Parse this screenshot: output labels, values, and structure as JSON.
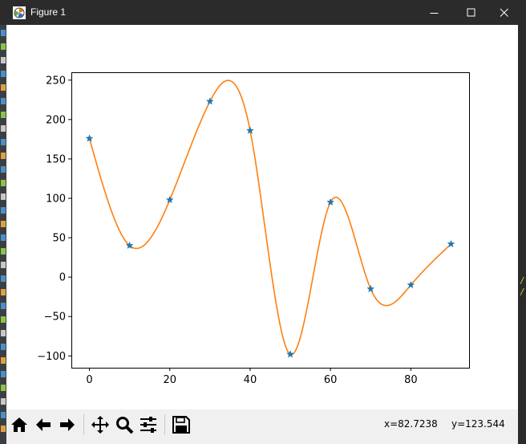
{
  "window": {
    "title": "Figure 1"
  },
  "icons": {
    "app": "matplotlib-figure-icon",
    "minimize": "minimize-icon",
    "maximize": "maximize-icon",
    "close": "close-icon"
  },
  "toolbar": {
    "buttons": [
      {
        "name": "home",
        "icon": "home-icon"
      },
      {
        "name": "back",
        "icon": "arrow-left-icon"
      },
      {
        "name": "forward",
        "icon": "arrow-right-icon"
      },
      {
        "name": "pan",
        "icon": "move-icon"
      },
      {
        "name": "zoom",
        "icon": "magnifier-icon"
      },
      {
        "name": "configure-subplots",
        "icon": "sliders-icon"
      },
      {
        "name": "save",
        "icon": "floppy-disk-icon"
      }
    ],
    "coord_x": "x=82.7238",
    "coord_y": "y=123.544"
  },
  "colors": {
    "titlebar_bg": "#2b2b2b",
    "toolbar_bg": "#f0f0f0",
    "markers": "#1f77b4",
    "curve": "#ff7f0e"
  },
  "chart_data": {
    "type": "line",
    "title": "",
    "xlabel": "",
    "ylabel": "",
    "xlim": [
      -4.5,
      94.5
    ],
    "ylim": [
      -115,
      260
    ],
    "xticks": [
      0,
      20,
      40,
      60,
      80
    ],
    "yticks": [
      -100,
      -50,
      0,
      50,
      100,
      150,
      200,
      250
    ],
    "xtick_labels": [
      "0",
      "20",
      "40",
      "60",
      "80"
    ],
    "ytick_labels": [
      "−100",
      "−50",
      "0",
      "50",
      "100",
      "150",
      "200",
      "250"
    ],
    "grid": false,
    "series": [
      {
        "style": "marker-star",
        "color": "#1f77b4",
        "x": [
          0,
          10,
          20,
          30,
          40,
          50,
          60,
          70,
          80,
          90
        ],
        "y": [
          176,
          40,
          98,
          223,
          186,
          -98,
          95,
          -15,
          -10,
          42
        ]
      },
      {
        "style": "smooth-line",
        "color": "#ff7f0e",
        "x": [
          0,
          10,
          20,
          30,
          40,
          50,
          60,
          70,
          80,
          90
        ],
        "y": [
          176,
          40,
          98,
          223,
          186,
          -98,
          95,
          -15,
          -10,
          42
        ]
      }
    ]
  }
}
